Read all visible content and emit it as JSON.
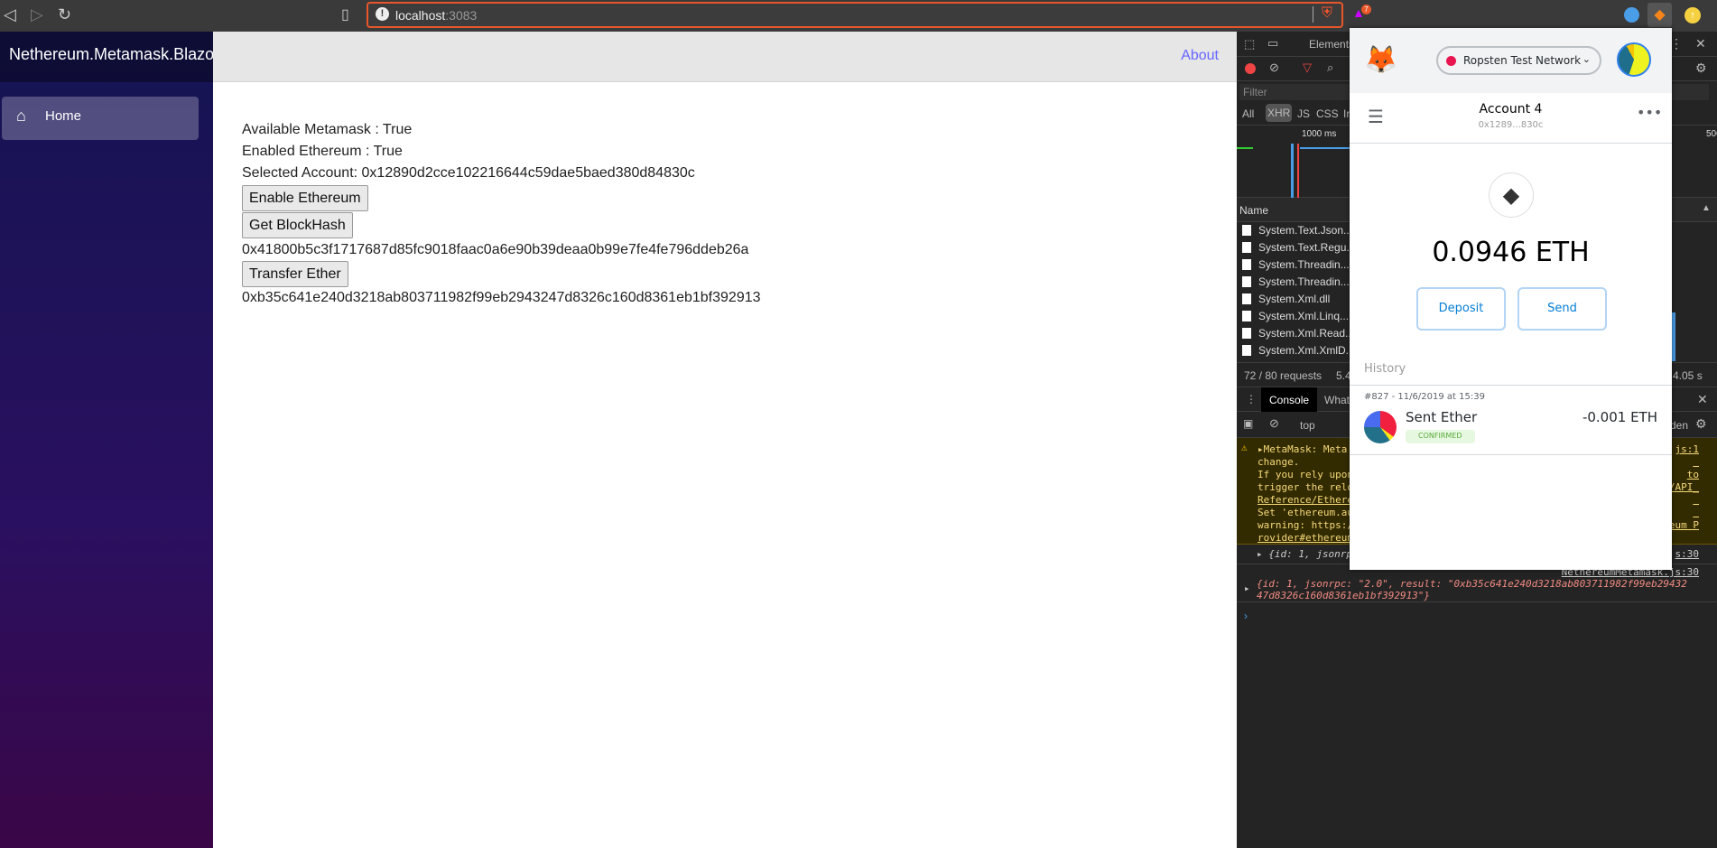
{
  "browser": {
    "url_host": "localhost",
    "url_port": ":3083",
    "brave_badge": "7"
  },
  "app": {
    "brand": "Nethereum.Metamask.Blazor",
    "nav_home": "Home",
    "about": "About",
    "available": "Available Metamask : True",
    "enabled": "Enabled Ethereum : True",
    "selected": "Selected Account: 0x12890d2cce102216644c59dae5baed380d84830c",
    "enable_btn": "Enable Ethereum",
    "blockhash_btn": "Get BlockHash",
    "blockhash": "0x41800b5c3f1717687d85fc9018faac0a6e90b39deaa0b99e7fe4fe796ddeb26a",
    "transfer_btn": "Transfer Ether",
    "tx_hash": "0xb35c641e240d3218ab803711982f99eb2943247d8326c160d8361eb1bf392913"
  },
  "devtools": {
    "tab_elements": "Elements",
    "filter_placeholder": "Filter",
    "types": [
      "All",
      "XHR",
      "JS",
      "CSS",
      "Ir"
    ],
    "timeline_1000": "1000 ms",
    "timeline_500": "500",
    "name_header": "Name",
    "requests": [
      "System.Text.Json....",
      "System.Text.Regu...",
      "System.Threadin...",
      "System.Threadin...",
      "System.Xml.dll",
      "System.Xml.Linq....",
      "System.Xml.Read...",
      "System.Xml.XmlD..."
    ],
    "status_requests": "72 / 80 requests",
    "status_size": "5.4",
    "status_time": "4.05 s",
    "drawer_console": "Console",
    "drawer_whats": "What",
    "context": "top",
    "levels": "den",
    "warning_left": [
      "MetaMask: Meta",
      "change.",
      "If you rely upon",
      "trigger the relo",
      "Reference/Ethere",
      "Set 'ethereum.au",
      "warning: https:/",
      "rovider#ethereum"
    ],
    "warning_right": [
      "js:1",
      "",
      "to",
      "/API_",
      "",
      "",
      "eum P",
      ""
    ],
    "log1_left": "{id: 1, jsonrpc",
    "log1_src": "s:30",
    "log2_src": "NethereumMetamask.js:30",
    "log2_line1": "{id: 1, jsonrpc: \"2.0\", result: \"0xb35c641e240d3218ab803711982f99eb29432",
    "log2_line2": "47d8326c160d8361eb1bf392913\"}"
  },
  "metamask": {
    "network": "Ropsten Test Network",
    "account": "Account 4",
    "address": "0x1289...830c",
    "balance": "0.0946",
    "unit": "ETH",
    "deposit": "Deposit",
    "send": "Send",
    "history": "History",
    "tx": {
      "meta": "#827 - 11/6/2019 at 15:39",
      "title": "Sent Ether",
      "amount": "-0.001 ETH",
      "status": "CONFIRMED"
    },
    "colors": {
      "network_dot": "#e91550",
      "accent": "#037dd6",
      "confirmed_bg": "#e6f8e0",
      "confirmed_text": "#5bab3d"
    }
  }
}
